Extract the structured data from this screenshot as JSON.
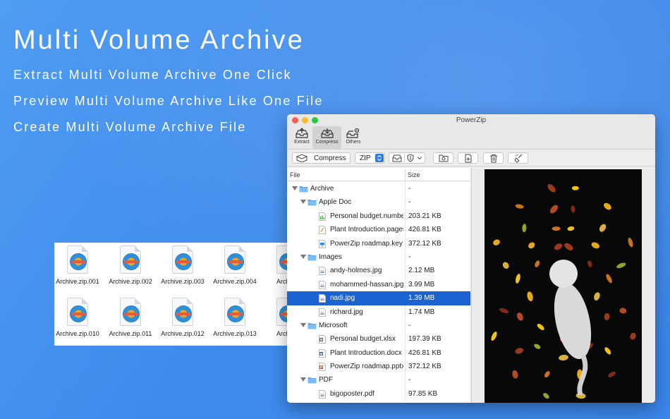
{
  "promo": {
    "headline": "Multi Volume Archive",
    "lines": [
      "Extract Multi Volume Archive One Click",
      "Preview Multi Volume Archive Like One File",
      "Create Multi Volume Archive File"
    ]
  },
  "archive_files": [
    "Archive.zip.001",
    "Archive.zip.002",
    "Archive.zip.003",
    "Archive.zip.004",
    "Archive",
    "Archive.zip.010",
    "Archive.zip.011",
    "Archive.zip.012",
    "Archive.zip.013",
    "Archive"
  ],
  "window": {
    "title": "PowerZip",
    "tools": [
      {
        "label": "Extract",
        "icon": "tray-up-icon"
      },
      {
        "label": "Compress",
        "icon": "tray-down-icon"
      },
      {
        "label": "Others",
        "icon": "tray-gear-icon"
      }
    ],
    "toolbar": {
      "compress_label": "Compress",
      "format_value": "ZIP"
    },
    "columns": {
      "file": "File",
      "size": "Size"
    },
    "rows": [
      {
        "level": 0,
        "type": "folder",
        "name": "Archive",
        "size": "-"
      },
      {
        "level": 1,
        "type": "folder",
        "name": "Apple Doc",
        "size": "-"
      },
      {
        "level": 2,
        "type": "numbers",
        "name": "Personal budget.numbers",
        "size": "203.21 KB"
      },
      {
        "level": 2,
        "type": "pages",
        "name": "Plant Introduction.pages",
        "size": "426.81 KB"
      },
      {
        "level": 2,
        "type": "keynote",
        "name": "PowerZip roadmap.key",
        "size": "372.12 KB"
      },
      {
        "level": 1,
        "type": "folder",
        "name": "Images",
        "size": "-"
      },
      {
        "level": 2,
        "type": "image",
        "name": "andy-holmes.jpg",
        "size": "2.12 MB"
      },
      {
        "level": 2,
        "type": "image",
        "name": "mohammed-hassan.jpg",
        "size": "3.99 MB"
      },
      {
        "level": 2,
        "type": "image",
        "name": "nadi.jpg",
        "size": "1.39 MB",
        "selected": true
      },
      {
        "level": 2,
        "type": "image",
        "name": "richard.jpg",
        "size": "1.74 MB"
      },
      {
        "level": 1,
        "type": "folder",
        "name": "Microsoft",
        "size": "-"
      },
      {
        "level": 2,
        "type": "excel",
        "name": "Personal budget.xlsx",
        "size": "197.39 KB"
      },
      {
        "level": 2,
        "type": "word",
        "name": "Plant Introduction.docx",
        "size": "426.81 KB"
      },
      {
        "level": 2,
        "type": "powerpoint",
        "name": "PowerZip roadmap.pptx",
        "size": "372.12 KB"
      },
      {
        "level": 1,
        "type": "folder",
        "name": "PDF",
        "size": "-"
      },
      {
        "level": 2,
        "type": "pdf",
        "name": "bigoposter.pdf",
        "size": "97.85 KB"
      }
    ]
  },
  "colors": {
    "background": "#3f8bec",
    "selection": "#1a63d0",
    "folder": "#5aa9ee"
  }
}
